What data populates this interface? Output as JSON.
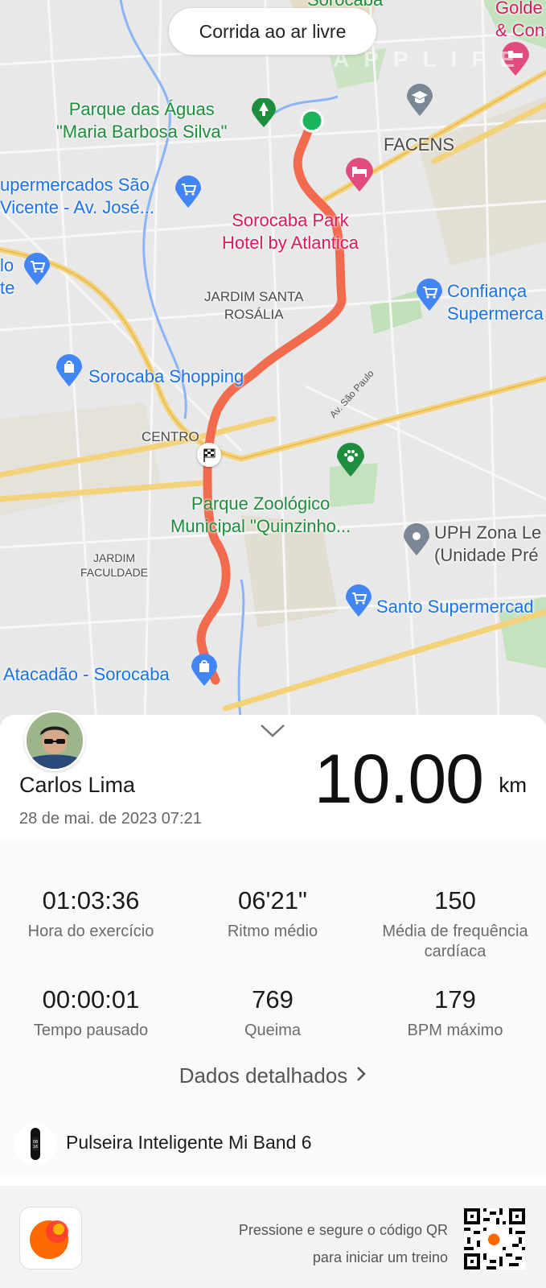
{
  "header": {
    "title": "Corrida ao ar livre",
    "watermark": "APPLIFE"
  },
  "map": {
    "labels": {
      "parque_aguas": "Parque das Águas\n\"Maria Barbosa Silva\"",
      "facens": "FACENS",
      "supermercados": "upermercados São\nVicente - Av. José...",
      "hotel": "Sorocaba Park\nHotel by Atlantica",
      "jardim_santa": "JARDIM SANTA\nROSÁLIA",
      "lo": "lo\nte",
      "confianca": "Confiança\nSupermerca",
      "shopping": "Sorocaba Shopping",
      "av_sao_paulo": "Av. São Paulo",
      "centro": "CENTRO",
      "zoologico": "Parque Zoológico\nMunicipal \"Quinzinho...",
      "uph": "UPH Zona Le\n(Unidade Pré",
      "jardim_faculdade": "JARDIM\nFACULDADE",
      "santo": "Santo Supermercad",
      "atacadao": "Atacadão - Sorocaba",
      "sorocaba_top": "Sorocaba",
      "golden": "Golde\n& Con"
    }
  },
  "user": {
    "name": "Carlos Lima",
    "date": "28 de mai. de 2023 07:21"
  },
  "summary": {
    "distance": "10.00",
    "unit": "km"
  },
  "stats": [
    {
      "value": "01:03:36",
      "label": "Hora do exercício"
    },
    {
      "value": "06'21\"",
      "label": "Ritmo médio"
    },
    {
      "value": "150",
      "label": "Média de frequência cardíaca"
    },
    {
      "value": "00:00:01",
      "label": "Tempo pausado"
    },
    {
      "value": "769",
      "label": "Queima"
    },
    {
      "value": "179",
      "label": "BPM máximo"
    }
  ],
  "details": {
    "label": "Dados detalhados"
  },
  "device": {
    "name": "Pulseira Inteligente Mi Band 6"
  },
  "footer": {
    "qr_line1": "Pressione e segure o código QR",
    "qr_line2": "para iniciar um treino"
  },
  "colors": {
    "route": "#f26b4f",
    "start_point": "#19b35c",
    "accent": "#ff6a00"
  }
}
